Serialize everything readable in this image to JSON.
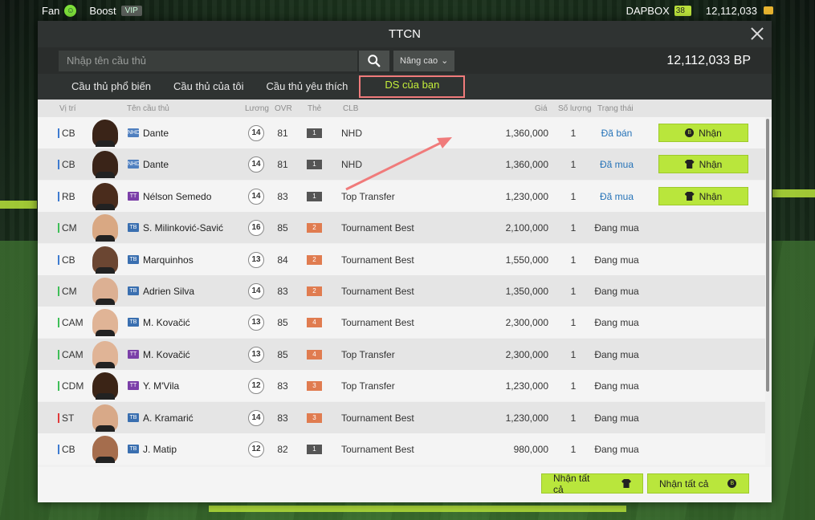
{
  "colors": {
    "accent": "#b9e63c",
    "tab_highlight_border": "#f07b7b",
    "status_done": "#2673b8"
  },
  "hud": {
    "fan_label": "Fan",
    "boost_label": "Boost",
    "vip_badge": "VIP",
    "dapbox_label": "DAPBOX",
    "dapbox_count": "38",
    "bp": "12,112,033"
  },
  "modal": {
    "title": "TTCN",
    "search_placeholder": "Nhập tên cầu thủ",
    "advanced_label": "Nâng cao",
    "bp_total": "12,112,033 BP",
    "tabs": [
      {
        "label": "Cầu thủ phổ biến",
        "active": false
      },
      {
        "label": "Cầu thủ của tôi",
        "active": false
      },
      {
        "label": "Cầu thủ yêu thích",
        "active": false
      },
      {
        "label": "DS của bạn",
        "active": true
      }
    ],
    "columns": {
      "position": "Vị trí",
      "name": "Tên cầu thủ",
      "salary": "Lương",
      "ovr": "OVR",
      "level": "Thẻ",
      "club": "CLB",
      "price": "Giá",
      "quantity": "Số lượng",
      "status": "Trạng thái"
    },
    "rows": [
      {
        "pos": "CB",
        "season": "NHD",
        "name": "Dante",
        "salary": "14",
        "ovr": "81",
        "level": "1",
        "club": "NHD",
        "price": "1,360,000",
        "qty": "1",
        "status": "Đã bán",
        "action": "Nhận"
      },
      {
        "pos": "CB",
        "season": "NHD",
        "name": "Dante",
        "salary": "14",
        "ovr": "81",
        "level": "1",
        "club": "NHD",
        "price": "1,360,000",
        "qty": "1",
        "status": "Đã mua",
        "action": "Nhận"
      },
      {
        "pos": "RB",
        "season": "TT",
        "name": "Nélson Semedo",
        "salary": "14",
        "ovr": "83",
        "level": "1",
        "club": "Top Transfer",
        "price": "1,230,000",
        "qty": "1",
        "status": "Đã mua",
        "action": "Nhận"
      },
      {
        "pos": "CM",
        "season": "TB",
        "name": "S. Milinković-Savić",
        "salary": "16",
        "ovr": "85",
        "level": "2",
        "club": "Tournament Best",
        "price": "2,100,000",
        "qty": "1",
        "status": "Đang mua"
      },
      {
        "pos": "CB",
        "season": "TB",
        "name": "Marquinhos",
        "salary": "13",
        "ovr": "84",
        "level": "2",
        "club": "Tournament Best",
        "price": "1,550,000",
        "qty": "1",
        "status": "Đang mua"
      },
      {
        "pos": "CM",
        "season": "TB",
        "name": "Adrien Silva",
        "salary": "14",
        "ovr": "83",
        "level": "2",
        "club": "Tournament Best",
        "price": "1,350,000",
        "qty": "1",
        "status": "Đang mua"
      },
      {
        "pos": "CAM",
        "season": "TB",
        "name": "M. Kovačić",
        "salary": "13",
        "ovr": "85",
        "level": "4",
        "club": "Tournament Best",
        "price": "2,300,000",
        "qty": "1",
        "status": "Đang mua"
      },
      {
        "pos": "CAM",
        "season": "TT",
        "name": "M. Kovačić",
        "salary": "13",
        "ovr": "85",
        "level": "4",
        "club": "Top Transfer",
        "price": "2,300,000",
        "qty": "1",
        "status": "Đang mua"
      },
      {
        "pos": "CDM",
        "season": "TT",
        "name": "Y. M'Vila",
        "salary": "12",
        "ovr": "83",
        "level": "3",
        "club": "Top Transfer",
        "price": "1,230,000",
        "qty": "1",
        "status": "Đang mua"
      },
      {
        "pos": "ST",
        "season": "TB",
        "name": "A. Kramarić",
        "salary": "14",
        "ovr": "83",
        "level": "3",
        "club": "Tournament Best",
        "price": "1,230,000",
        "qty": "1",
        "status": "Đang mua"
      },
      {
        "pos": "CB",
        "season": "TB",
        "name": "J. Matip",
        "salary": "12",
        "ovr": "82",
        "level": "1",
        "club": "Tournament Best",
        "price": "980,000",
        "qty": "1",
        "status": "Đang mua"
      }
    ],
    "footer": {
      "claim_all_players": "Nhận tất cả",
      "claim_all_bp": "Nhận tất cả"
    }
  }
}
